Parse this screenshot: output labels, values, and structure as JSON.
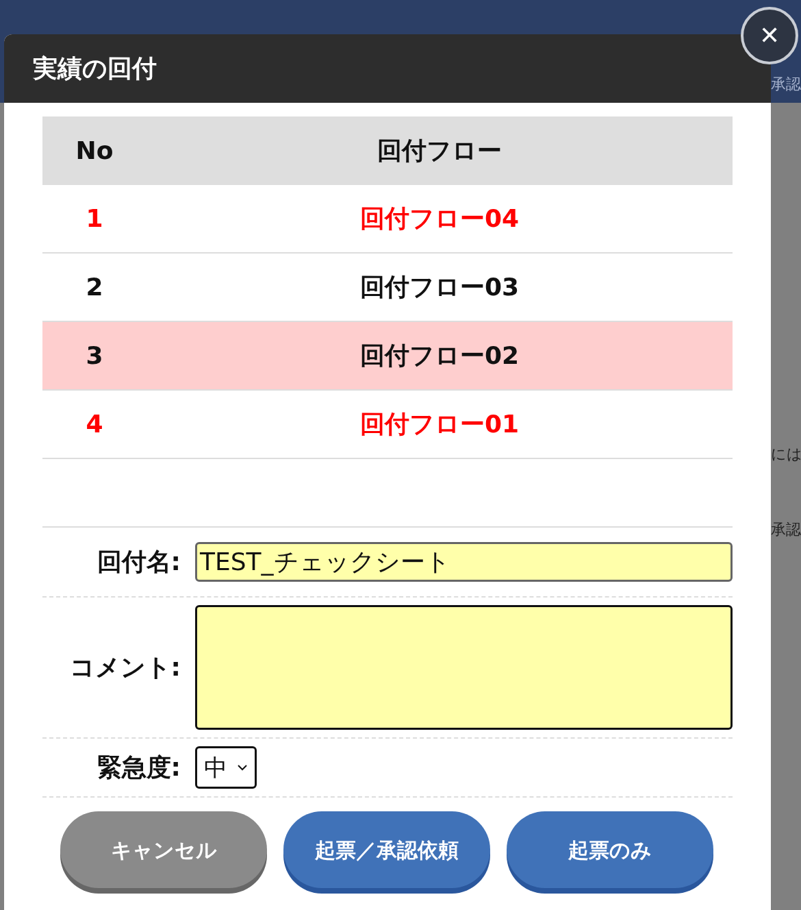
{
  "background": {
    "fragments": [
      "承認",
      "には",
      "承認"
    ]
  },
  "dialog": {
    "title": "実績の回付",
    "close": "✕",
    "table": {
      "columns": [
        "No",
        "回付フロー"
      ],
      "rows": [
        {
          "no": "1",
          "flow": "回付フロー04",
          "alert": true,
          "selected": false
        },
        {
          "no": "2",
          "flow": "回付フロー03",
          "alert": false,
          "selected": false
        },
        {
          "no": "3",
          "flow": "回付フロー02",
          "alert": false,
          "selected": true
        },
        {
          "no": "4",
          "flow": "回付フロー01",
          "alert": true,
          "selected": false
        }
      ]
    },
    "form": {
      "name_label": "回付名:",
      "name_value": "TEST_チェックシート",
      "comment_label": "コメント:",
      "urgency_label": "緊急度:",
      "urgency_value": "中"
    },
    "buttons": [
      {
        "label": "キャンセル",
        "kind": "secondary"
      },
      {
        "label": "起票／承認依頼",
        "kind": "primary"
      },
      {
        "label": "起票のみ",
        "kind": "primary"
      }
    ]
  }
}
